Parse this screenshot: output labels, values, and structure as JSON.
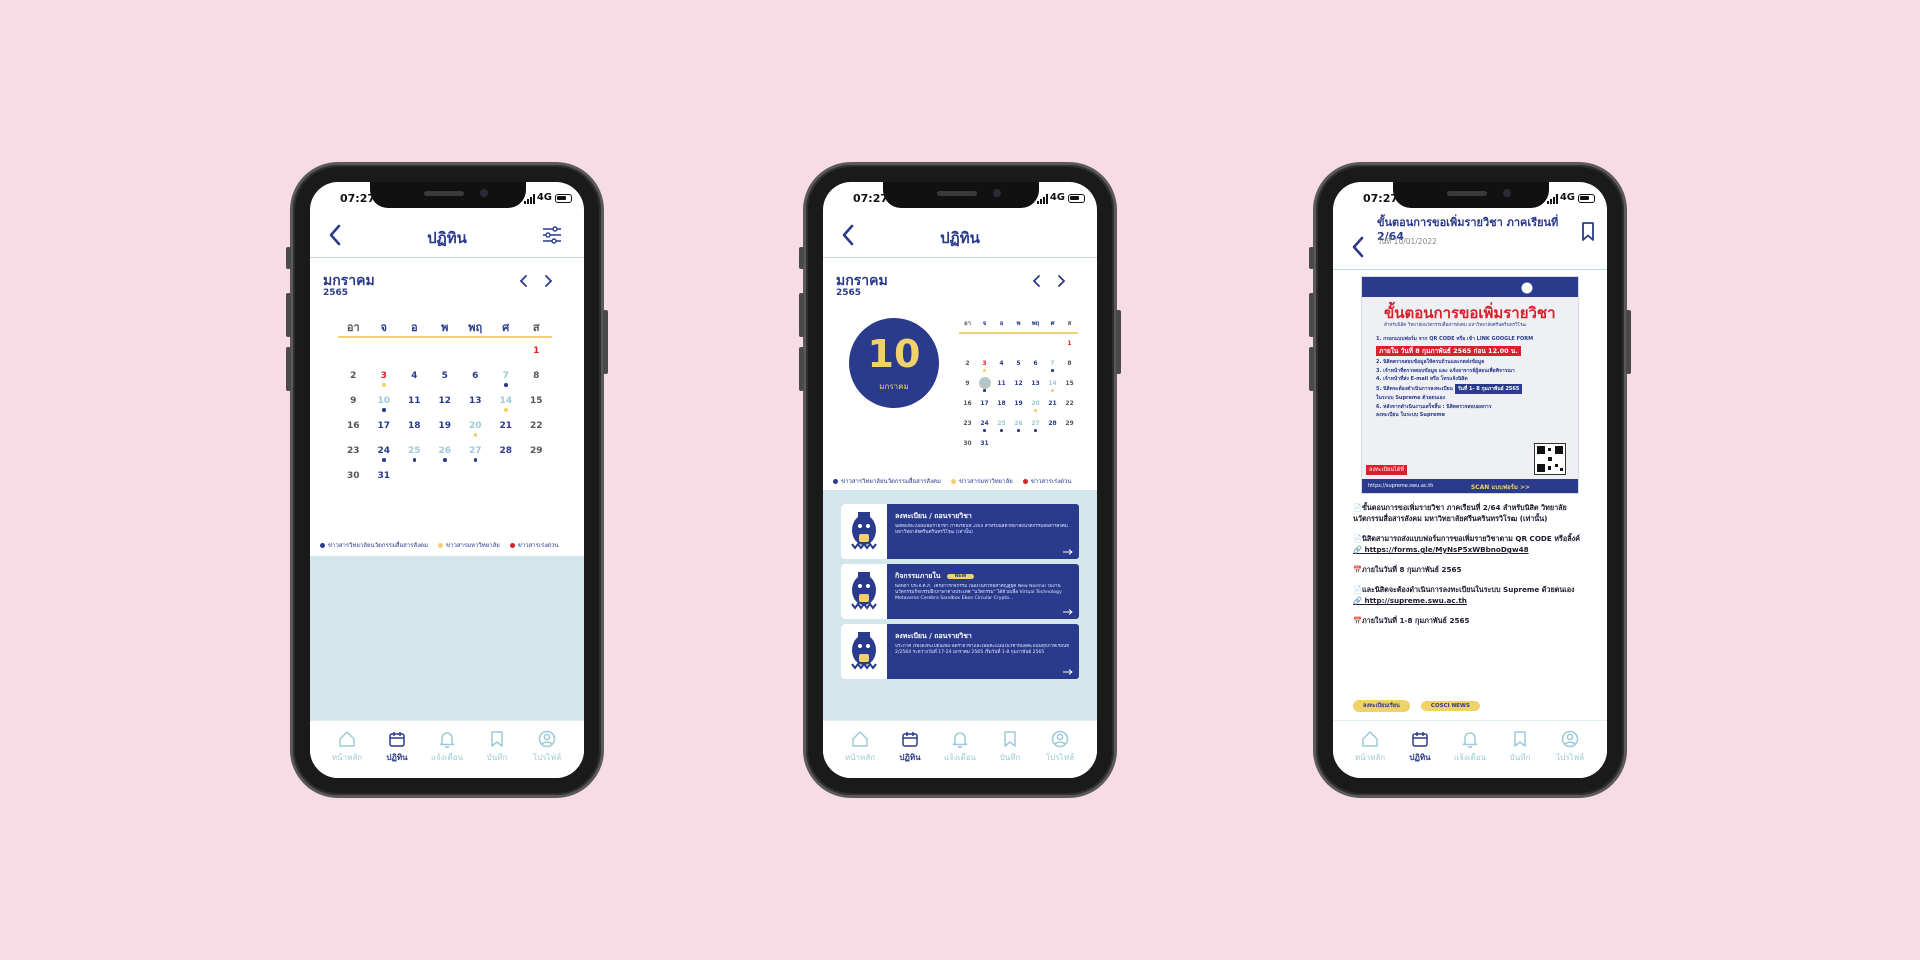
{
  "status": {
    "time": "07:27",
    "network": "4G"
  },
  "calendar": {
    "title": "ปฏิทิน",
    "month": "มกราคม",
    "year": "2565",
    "weekdays": [
      "อา",
      "จ",
      "อ",
      "พ",
      "พฤ",
      "ศ",
      "ส"
    ],
    "days": [
      "1",
      "2",
      "3",
      "4",
      "5",
      "6",
      "7",
      "8",
      "9",
      "10",
      "11",
      "12",
      "13",
      "14",
      "15",
      "16",
      "17",
      "18",
      "19",
      "20",
      "21",
      "22",
      "23",
      "24",
      "25",
      "26",
      "27",
      "28",
      "29",
      "30",
      "31"
    ],
    "legend": [
      "ข่าวสารวิทยาลัยนวัตกรรมสื่อสารสังคม",
      "ข่าวสารมหาวิทยาลัย",
      "ข่าวสารเร่งด่วน"
    ],
    "colors": {
      "navy": "#2a3a8c",
      "yellow": "#f1d26a",
      "red": "#d7212b",
      "muted": "#9ccad8",
      "grey": "#555555"
    }
  },
  "selected": {
    "day": "10",
    "month": "มกราคม"
  },
  "cards": [
    {
      "title": "ลงทะเบียน / ถอนรายวิชา",
      "badge": "",
      "body": "นิสิตลงทะเบียนเพิ่มรายวิชา ภาคเรียนที่ 2/64 สำหรับนิสิตวิทยาลัยนวัตกรรมสื่อสารสังคม มหาวิทยาลัยศรีนครินทรวิโรฒ (เท่านั้น)"
    },
    {
      "title": "กิจกรรมภายใน",
      "badge": "NEW",
      "body": "พลพยา ประจ.ศ.ภ. โครงการกิจกรรม เนื่องในหัวข้อสำคัญสู่ยุค New Normal ในงานนวัตกรรมกิจกรรมฝึกภาษาต่างประเทศ \"นวัตกรรม\" ได้ด้วยเพื่อ Virtual Technology Metaverse Cerebra Sandbox Ebeo Circular Crypto..."
    },
    {
      "title": "ลงทะเบียน / ถอนรายวิชา",
      "badge": "",
      "body": "ประกาศ เรื่องลงทะเบียนเพิ่ม-ลดรายวิชาและเพิ่มคะแนนในวิชาหมดคะแนนทุกภาคเรียนที่ 2/2564 ระหว่างวันที่ 17-24 มกราคม 2565 เริ่มวันที่ 1-8 กุมภาพันธ์ 2565"
    }
  ],
  "tabs": [
    "หน้าหลัก",
    "ปฏิทิน",
    "แจ้งเตือน",
    "บันทึก",
    "โปรไฟล์"
  ],
  "post": {
    "title": "ขั้นตอนการขอเพิ่มรายวิชา ภาคเรียนที่ 2/64",
    "date": "วันที่ 10/01/2022",
    "poster": {
      "heading": "ขั้นตอนการขอเพิ่มรายวิชา",
      "sub": "สำหรับนิสิต วิทยาลัยนวัตกรรมสื่อสารสังคม มหาวิทยาลัยศรีนครินทรวิโรฒ",
      "step1": "1. กรอกแบบฟอร์ม จาก QR CODE หรือ เข้า LINK GOOGLE FORM",
      "deadline": "ภายใน วันที่ 8 กุมภาพันธ์ 2565 ก่อน 12.00 น.",
      "step2": "2. นิสิตตรวจสอบข้อมูลให้ครบถ้วนและกดส่งข้อมูล",
      "step3": "3. เจ้าหน้าที่ตรวจสอบข้อมูล และ แจ้งอาจารย์ผู้สอนเพื่อพิจารณา",
      "step4": "4. เจ้าหน้าที่ส่ง E-mail หรือ โทรแจ้งนิสิต",
      "step5": "5. นิสิตจะต้องดำเนินการลงทะเบียน",
      "range": "วันที่ 1- 8 กุมภาพันธ์ 2565",
      "step5b": "ในระบบ Supreme ด้วยตนเอง",
      "step6": "6. หลังจากดำเนินงานเสร็จสิ้น : นิสิตตรวจสอบผลการลงทะเบียน ในระบบ Supreme",
      "tag": "ลงทะเบียนได้ที่",
      "url": "https://supreme.swu.ac.th",
      "scan": "SCAN แบบฟอร์ม >>"
    },
    "p1": "📄ขั้นตอนการขอเพิ่มรายวิชา ภาคเรียนที่ 2/64 สำหรับนิสิต วิทยาลัยนวัตกรรมสื่อสารสังคม มหาวิทยาลัยศรีนครินทรวิโรฒ (เท่านั้น)",
    "p2": "📄นิสิตสามารถส่งแบบฟอร์มการขอเพิ่มรายวิชาตาม QR CODE หรือลิ้งค์",
    "link1": "🔗 https://forms.gle/MyNsP5xWBbnoDgw48",
    "p3": "📅ภายในวันที่ 8 กุมภาพันธ์ 2565",
    "p4": "📄และนิสิตจะต้องดำเนินการลงทะเบียนในระบบ Supreme ด้วยตนเอง",
    "link2": "🔗 http://supreme.swu.ac.th",
    "p5": "📅ภายในวันที่ 1-8 กุมภาพันธ์ 2565",
    "tags": [
      "ลงทะเบียนเรียน",
      "COSCI NEWS"
    ]
  }
}
